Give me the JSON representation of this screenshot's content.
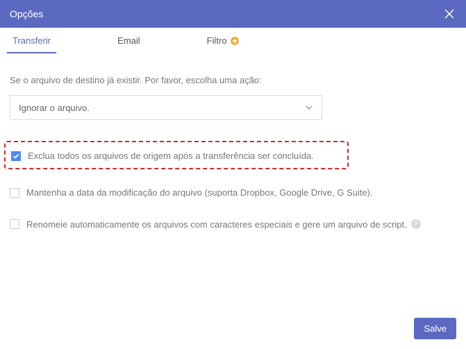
{
  "header": {
    "title": "Opções"
  },
  "tabs": {
    "transfer": "Transferir",
    "email": "Email",
    "filter": "Filtro"
  },
  "content": {
    "prompt": "Se o arquivo de destino já existir. Por favor, escolha uma ação:",
    "select_value": "Ignorar o arquivo.",
    "opt_delete_source": "Exclua todos os arquivos de origem após a transferência ser concluída.",
    "opt_keep_date": "Mantenha a data da modificação do arquivo (suporta Dropbox, Google Drive, G Suite).",
    "opt_rename_special": "Renomeie automaticamente os arquivos com caracteres especiais e gere um arquivo de script.",
    "help_icon": "?"
  },
  "footer": {
    "save": "Salve"
  }
}
